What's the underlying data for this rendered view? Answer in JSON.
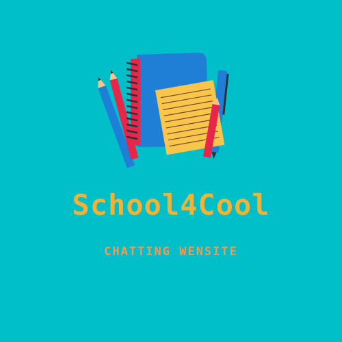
{
  "brand": {
    "title": "School4Cool",
    "subtitle": "CHATTING WENSITE"
  },
  "colors": {
    "background": "#00BFC9",
    "title": "#F2B233",
    "subtitle": "#F29A53",
    "notebook": "#1F7FD6",
    "spiral": "#E8264A",
    "paper": "#F9C64B",
    "pencil_blue": "#1F7FD6",
    "pencil_red": "#E8264A"
  },
  "icons": [
    "blue-pencil-icon",
    "red-pencil-icon",
    "spiral-notebook-icon",
    "lined-note-paper-icon",
    "red-pen-icon",
    "blue-pen-icon"
  ]
}
